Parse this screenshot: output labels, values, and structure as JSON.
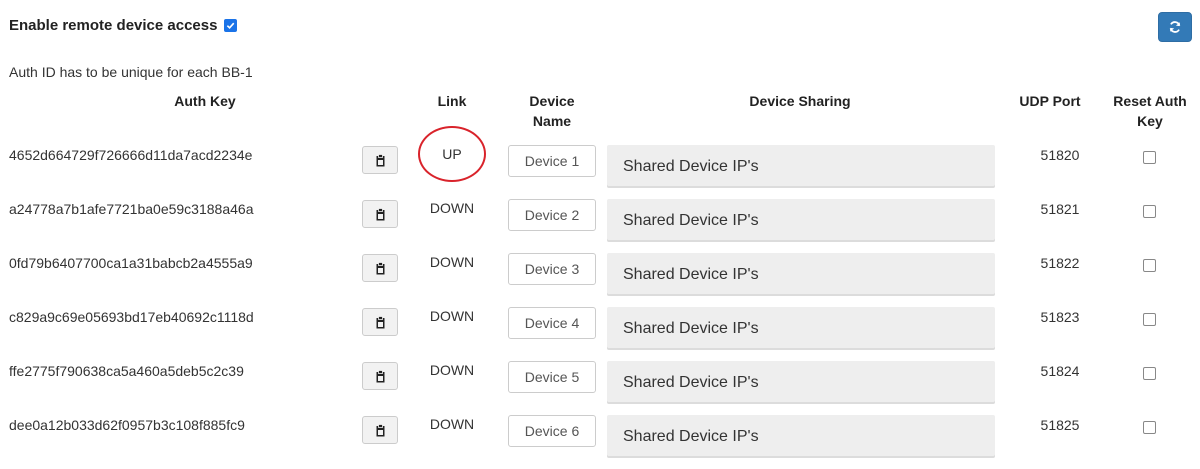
{
  "remote_access": {
    "label": "Enable remote device access",
    "checked": true
  },
  "note": "Auth ID has to be unique for each BB-1",
  "headers": {
    "auth_key": "Auth Key",
    "link": "Link",
    "device_name_1": "Device",
    "device_name_2": "Name",
    "device_sharing": "Device Sharing",
    "udp_port": "UDP Port",
    "reset_auth_key_1": "Reset Auth",
    "reset_auth_key_2": "Key"
  },
  "rows": [
    {
      "auth_key": "4652d664729f726666d11da7acd2234e",
      "link": "UP",
      "device_name": "Device 1",
      "sharing": "Shared Device IP's",
      "udp_port": "51820",
      "reset": false
    },
    {
      "auth_key": "a24778a7b1afe7721ba0e59c3188a46a",
      "link": "DOWN",
      "device_name": "Device 2",
      "sharing": "Shared Device IP's",
      "udp_port": "51821",
      "reset": false
    },
    {
      "auth_key": "0fd79b6407700ca1a31babcb2a4555a9",
      "link": "DOWN",
      "device_name": "Device 3",
      "sharing": "Shared Device IP's",
      "udp_port": "51822",
      "reset": false
    },
    {
      "auth_key": "c829a9c69e05693bd17eb40692c1118d",
      "link": "DOWN",
      "device_name": "Device 4",
      "sharing": "Shared Device IP's",
      "udp_port": "51823",
      "reset": false
    },
    {
      "auth_key": "ffe2775f790638ca5a460a5deb5c2c39",
      "link": "DOWN",
      "device_name": "Device 5",
      "sharing": "Shared Device IP's",
      "udp_port": "51824",
      "reset": false
    },
    {
      "auth_key": "dee0a12b033d62f0957b3c108f885fc9",
      "link": "DOWN",
      "device_name": "Device 6",
      "sharing": "Shared Device IP's",
      "udp_port": "51825",
      "reset": false
    }
  ],
  "icons": {
    "refresh": "refresh-icon",
    "copy": "clipboard-icon",
    "check": "check-icon"
  },
  "colors": {
    "accent": "#337ab7",
    "highlight_ring": "#d9232b"
  }
}
